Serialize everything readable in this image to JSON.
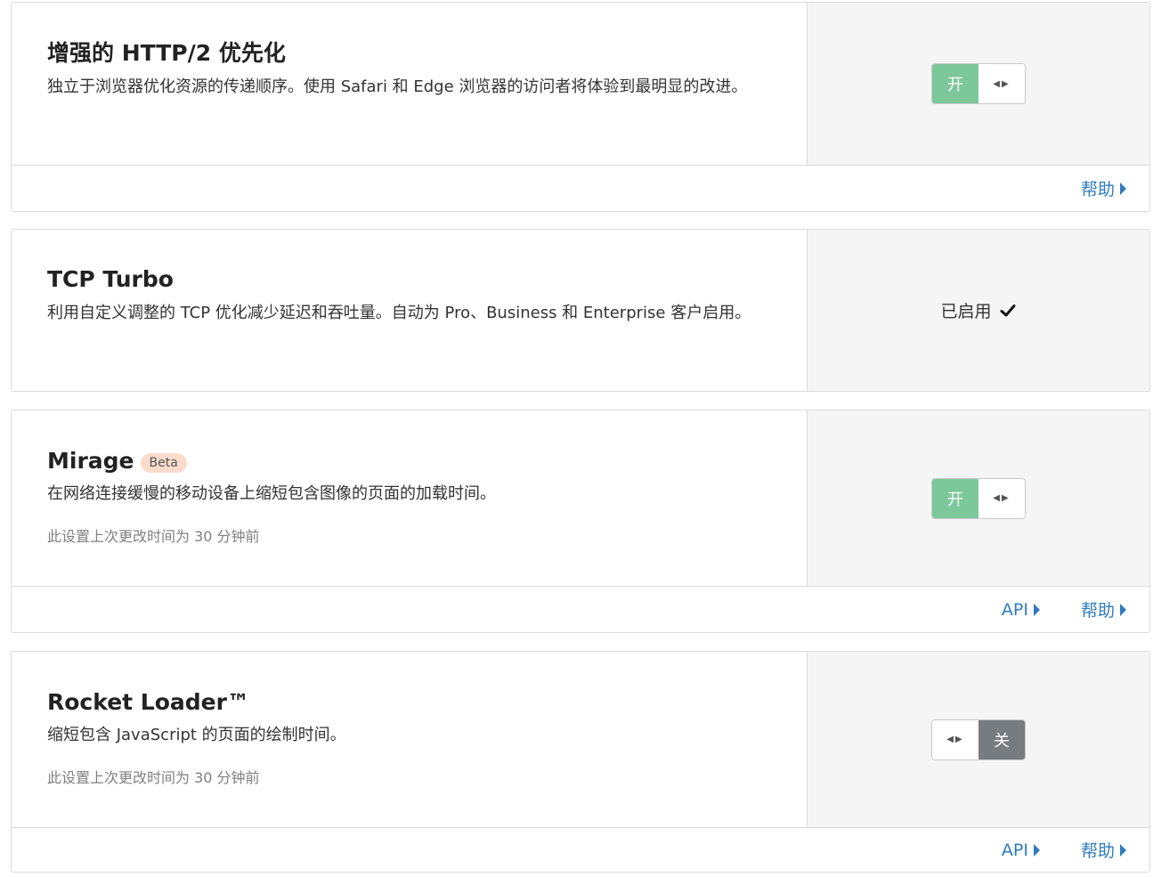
{
  "cards": [
    {
      "title": "增强的 HTTP/2 优先化",
      "description": "独立于浏览器优化资源的传递顺序。使用 Safari 和 Edge 浏览器的访问者将体验到最明显的改进。",
      "toggle_state": "on",
      "toggle_label": "开",
      "footer_links": [
        "帮助"
      ]
    },
    {
      "title": "TCP Turbo",
      "description": "利用自定义调整的 TCP 优化减少延迟和吞吐量。自动为 Pro、Business 和 Enterprise 客户启用。",
      "status_text": "已启用"
    },
    {
      "title": "Mirage",
      "badge": "Beta",
      "description": "在网络连接缓慢的移动设备上缩短包含图像的页面的加载时间。",
      "meta": "此设置上次更改时间为 30 分钟前",
      "toggle_state": "on",
      "toggle_label": "开",
      "footer_links": [
        "API",
        "帮助"
      ]
    },
    {
      "title": "Rocket Loader™",
      "description": "缩短包含 JavaScript 的页面的绘制时间。",
      "meta": "此设置上次更改时间为 30 分钟前",
      "toggle_state": "off",
      "toggle_label": "关",
      "footer_links": [
        "API",
        "帮助"
      ]
    }
  ],
  "colors": {
    "toggle_on": "#7cc89a",
    "toggle_off": "#777c81",
    "link": "#2f7bbf",
    "badge_bg": "#fbdccc",
    "panel_bg": "#f5f5f5"
  },
  "icons": {
    "toggle_handle": "arrows-left-right-icon",
    "enabled": "checkmark-icon",
    "link_caret": "caret-right-icon"
  }
}
